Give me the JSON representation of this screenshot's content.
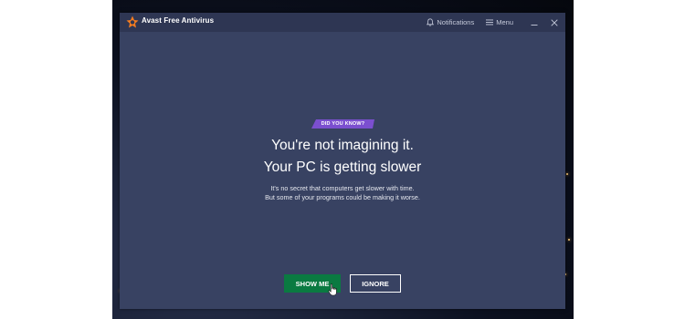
{
  "app": {
    "title": "Avast Free Antivirus",
    "brand_color": "#f47c20"
  },
  "titlebar": {
    "notifications_label": "Notifications",
    "menu_label": "Menu",
    "icons": [
      "bell-icon",
      "hamburger-icon",
      "minimize-icon",
      "close-icon"
    ]
  },
  "content": {
    "badge": "DID YOU KNOW?",
    "headline_line1": "You're not imagining it.",
    "headline_line2": "Your PC is getting slower",
    "body_line1": "It's no secret that computers get slower with time.",
    "body_line2": "But some of your programs could be making it worse."
  },
  "actions": {
    "show_me_label": "SHOW ME",
    "ignore_label": "IGNORE"
  },
  "colors": {
    "window_bg": "#384262",
    "titlebar_bg": "#2e3653",
    "badge_bg": "#7b4fcf",
    "primary_button": "#0a7a41"
  }
}
